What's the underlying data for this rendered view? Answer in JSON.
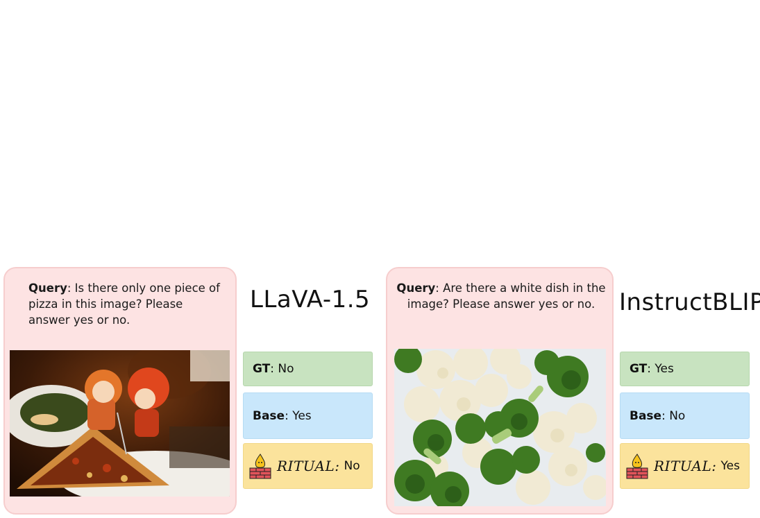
{
  "panels": [
    {
      "model_name": "LLaVA-1.5",
      "query_label": "Query",
      "query_text": ": Is there only one piece of pizza in this image? Please answer yes or no.",
      "image_subject": "figurines-with-pizza-photo",
      "gt_label": "GT",
      "gt_value": ": No",
      "base_label": "Base",
      "base_value": ": Yes",
      "ritual_label": "RITUAL:",
      "ritual_value": "No"
    },
    {
      "model_name": "InstructBLIP",
      "query_label": "Query",
      "query_text": ": Are there a white dish in the image? Please answer yes or no.",
      "image_subject": "broccoli-cauliflower-photo",
      "gt_label": "GT",
      "gt_value": ": Yes",
      "base_label": "Base",
      "base_value": ": No",
      "ritual_label": "RITUAL:",
      "ritual_value": "Yes"
    }
  ],
  "colors": {
    "query_bg": "#fde3e3",
    "gt_bg": "#c8e3c0",
    "base_bg": "#c9e7fb",
    "ritual_bg": "#fbe39c"
  },
  "icons": {
    "ritual_icon": "flame-on-brick-icon"
  }
}
